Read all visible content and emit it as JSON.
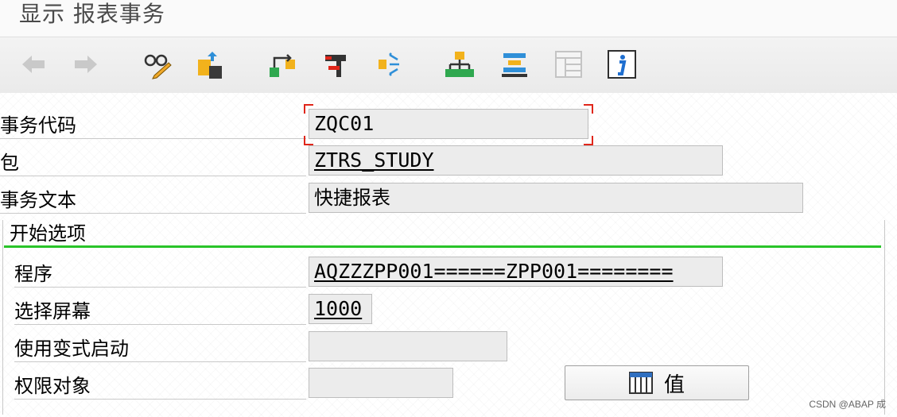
{
  "window": {
    "title": "显示 报表事务"
  },
  "toolbar": {
    "buttons": [
      {
        "name": "back-button",
        "icon": "arrow-left-icon",
        "enabled": false
      },
      {
        "name": "forward-button",
        "icon": "arrow-right-icon",
        "enabled": false
      },
      {
        "name": "display-change-button",
        "icon": "glasses-pencil-icon"
      },
      {
        "name": "other-object-button",
        "icon": "object-copy-icon"
      },
      {
        "name": "where-used-button",
        "icon": "where-used-icon"
      },
      {
        "name": "breakpoint-button",
        "icon": "breakpoint-icon"
      },
      {
        "name": "navigate-button",
        "icon": "navigate-arrows-icon"
      },
      {
        "name": "hierarchy-button",
        "icon": "hierarchy-icon"
      },
      {
        "name": "object-list-button",
        "icon": "object-list-icon"
      },
      {
        "name": "layout-button",
        "icon": "layout-grid-icon",
        "enabled": false
      },
      {
        "name": "info-button",
        "icon": "info-icon"
      }
    ]
  },
  "form": {
    "transaction_code": {
      "label": "事务代码",
      "value": "ZQC01"
    },
    "package": {
      "label": "包",
      "value": "ZTRS_STUDY"
    },
    "transaction_text": {
      "label": "事务文本",
      "value": "快捷报表"
    }
  },
  "start_options": {
    "title": "开始选项",
    "program": {
      "label": "程序",
      "value": "AQZZZPP001======ZPP001========"
    },
    "selection_screen": {
      "label": "选择屏幕",
      "value": "1000"
    },
    "start_with_variant": {
      "label": "使用变式启动",
      "value": ""
    },
    "authorization_object": {
      "label": "权限对象",
      "value": ""
    },
    "values_button": {
      "label": "值",
      "icon": "table-icon"
    }
  },
  "watermark": "CSDN @ABAP 成",
  "colors": {
    "group_line": "#29c429",
    "focus": "#e0261a",
    "field_bg": "#ececec"
  }
}
